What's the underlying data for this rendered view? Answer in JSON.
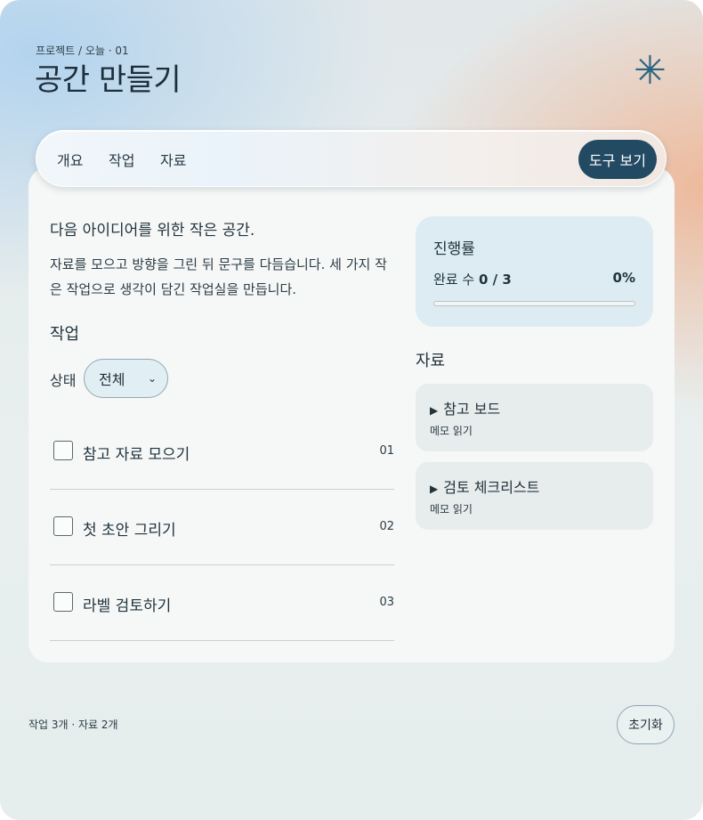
{
  "header": {
    "breadcrumb": "프로젝트 / 오늘 · 01",
    "title": "공간 만들기",
    "logo_icon": "asterisk-icon"
  },
  "nav": {
    "links": [
      "개요",
      "작업",
      "자료"
    ],
    "tools_button": "도구 보기"
  },
  "intro": {
    "title": "다음 아이디어를 위한 작은 공간.",
    "body": "자료를 모으고 방향을 그린 뒤 문구를 다듬습니다. 세 가지 작은 작업으로 생각이 담긴 작업실을 만듭니다."
  },
  "tasks": {
    "section_title": "작업",
    "filter_label": "상태",
    "filter_value": "전체",
    "items": [
      {
        "label": "참고 자료 모으기",
        "num": "01",
        "checked": false
      },
      {
        "label": "첫 초안 그리기",
        "num": "02",
        "checked": false
      },
      {
        "label": "라벨 검토하기",
        "num": "03",
        "checked": false
      }
    ]
  },
  "progress": {
    "title": "진행률",
    "count_label": "완료 수",
    "count_value": "0 / 3",
    "percent_text": "0%",
    "fraction": 0
  },
  "resources": {
    "section_title": "자료",
    "items": [
      {
        "title": "참고 보드",
        "sub": "메모 읽기"
      },
      {
        "title": "검토 체크리스트",
        "sub": "메모 읽기"
      }
    ]
  },
  "footer": {
    "summary": "작업 3개 · 자료 2개",
    "reset_button": "초기화"
  },
  "colors": {
    "accent": "#234a63",
    "progress_card": "#dcecf2",
    "icon": "#2c6580"
  }
}
